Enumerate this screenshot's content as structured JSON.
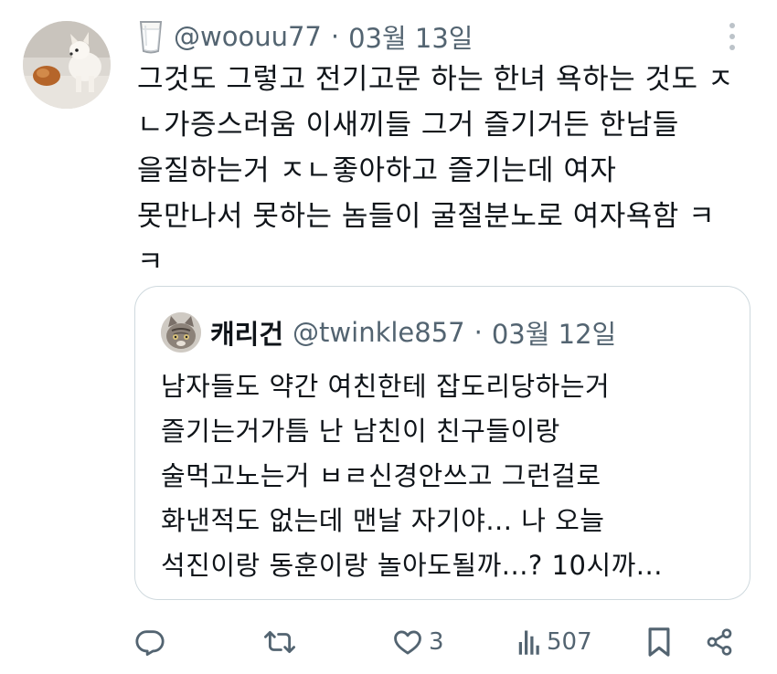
{
  "tweet": {
    "handle": "@woouu77",
    "separator": "·",
    "date": "03월 13일",
    "avatar_icon": "dog-photo-avatar",
    "emoji_icon": "glass-of-milk-icon",
    "lines": [
      "그것도 그렇고 전기고문 하는 한녀 욕하는 것도 ㅈ",
      "ㄴ가증스러움 이새끼들 그거 즐기거든 한남들",
      "을질하는거 ㅈㄴ좋아하고 즐기는데 여자",
      "못만나서 못하는 놈들이 굴절분노로 여자욕함 ㅋ",
      "ㅋ"
    ]
  },
  "quoted": {
    "name": "캐리건",
    "handle": "@twinkle857",
    "separator": "·",
    "date": "03월 12일",
    "avatar_icon": "cat-avatar",
    "lines": [
      "남자들도 약간 여친한테 잡도리당하는거",
      "즐기는거가틈 난 남친이 친구들이랑",
      "술먹고노는거 ㅂㄹ신경안쓰고 그런걸로",
      "화낸적도 없는데 맨날 자기야... 나 오늘",
      "석진이랑 동훈이랑 놀아도될까...? 10시까..."
    ]
  },
  "actions": {
    "reply_icon": "reply-icon",
    "retweet_icon": "retweet-icon",
    "like_icon": "heart-icon",
    "like_count": "3",
    "views_icon": "views-bar-chart-icon",
    "views_count": "507",
    "bookmark_icon": "bookmark-icon",
    "share_icon": "share-icon"
  },
  "colors": {
    "text": "#0f1419",
    "secondary": "#536471",
    "border": "#cfd9de"
  }
}
